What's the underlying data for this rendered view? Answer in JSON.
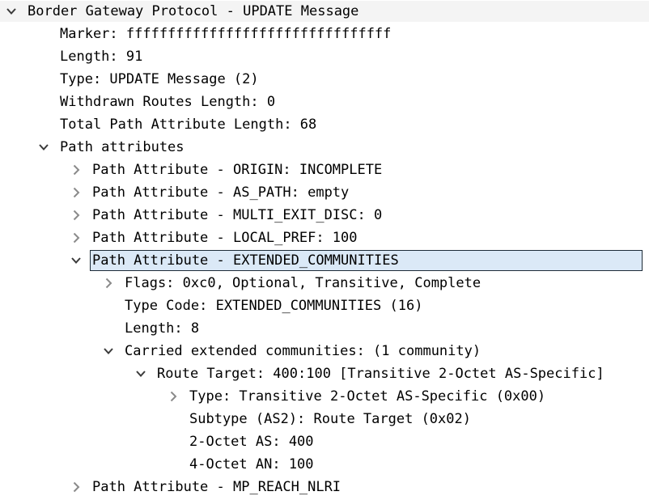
{
  "tree": {
    "rows": [
      {
        "text": "Border Gateway Protocol - UPDATE Message",
        "level": 0,
        "arrow": "down"
      },
      {
        "text": "Marker: ffffffffffffffffffffffffffffffff",
        "level": 1,
        "arrow": "none"
      },
      {
        "text": "Length: 91",
        "level": 1,
        "arrow": "none"
      },
      {
        "text": "Type: UPDATE Message (2)",
        "level": 1,
        "arrow": "none"
      },
      {
        "text": "Withdrawn Routes Length: 0",
        "level": 1,
        "arrow": "none"
      },
      {
        "text": "Total Path Attribute Length: 68",
        "level": 1,
        "arrow": "none"
      },
      {
        "text": "Path attributes",
        "level": 1,
        "arrow": "down"
      },
      {
        "text": "Path Attribute - ORIGIN: INCOMPLETE",
        "level": 2,
        "arrow": "right"
      },
      {
        "text": "Path Attribute - AS_PATH: empty",
        "level": 2,
        "arrow": "right"
      },
      {
        "text": "Path Attribute - MULTI_EXIT_DISC: 0",
        "level": 2,
        "arrow": "right"
      },
      {
        "text": "Path Attribute - LOCAL_PREF: 100",
        "level": 2,
        "arrow": "right"
      },
      {
        "text": "Path Attribute - EXTENDED_COMMUNITIES",
        "level": 2,
        "arrow": "down",
        "selected": true
      },
      {
        "text": "Flags: 0xc0, Optional, Transitive, Complete",
        "level": 3,
        "arrow": "right"
      },
      {
        "text": "Type Code: EXTENDED_COMMUNITIES (16)",
        "level": 3,
        "arrow": "none"
      },
      {
        "text": "Length: 8",
        "level": 3,
        "arrow": "none"
      },
      {
        "text": "Carried extended communities: (1 community)",
        "level": 3,
        "arrow": "down"
      },
      {
        "text": "Route Target: 400:100 [Transitive 2-Octet AS-Specific]",
        "level": 4,
        "arrow": "down"
      },
      {
        "text": "Type: Transitive 2-Octet AS-Specific (0x00)",
        "level": 5,
        "arrow": "right"
      },
      {
        "text": "Subtype (AS2): Route Target (0x02)",
        "level": 5,
        "arrow": "none"
      },
      {
        "text": "2-Octet AS: 400",
        "level": 5,
        "arrow": "none"
      },
      {
        "text": "4-Octet AN: 100",
        "level": 5,
        "arrow": "none"
      },
      {
        "text": "Path Attribute - MP_REACH_NLRI",
        "level": 2,
        "arrow": "right"
      }
    ]
  }
}
